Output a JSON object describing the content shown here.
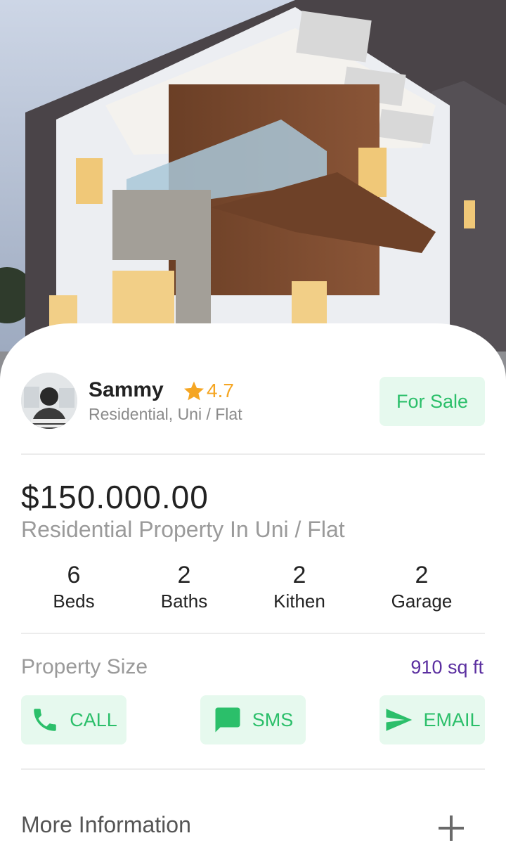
{
  "agent": {
    "name": "Sammy",
    "rating": "4.7",
    "type": "Residential, Uni / Flat"
  },
  "badge": {
    "label": "For Sale"
  },
  "listing": {
    "price": "$150.000.00",
    "subtitle": "Residential Property In Uni / Flat"
  },
  "stats": [
    {
      "value": "6",
      "label": "Beds"
    },
    {
      "value": "2",
      "label": "Baths"
    },
    {
      "value": "2",
      "label": "Kithen"
    },
    {
      "value": "2",
      "label": "Garage"
    }
  ],
  "property_size": {
    "label": "Property Size",
    "value": "910 sq ft"
  },
  "actions": [
    {
      "label": "CALL",
      "icon": "phone-icon"
    },
    {
      "label": "SMS",
      "icon": "message-icon"
    },
    {
      "label": "EMAIL",
      "icon": "send-icon"
    }
  ],
  "more_info": {
    "label": "More Information",
    "icon": "plus-icon"
  },
  "colors": {
    "accent": "#2bbf6a",
    "accent_bg": "#e6f9ee",
    "star": "#f5a623",
    "size_value": "#5b2fa0",
    "muted": "#9a9a9a"
  }
}
